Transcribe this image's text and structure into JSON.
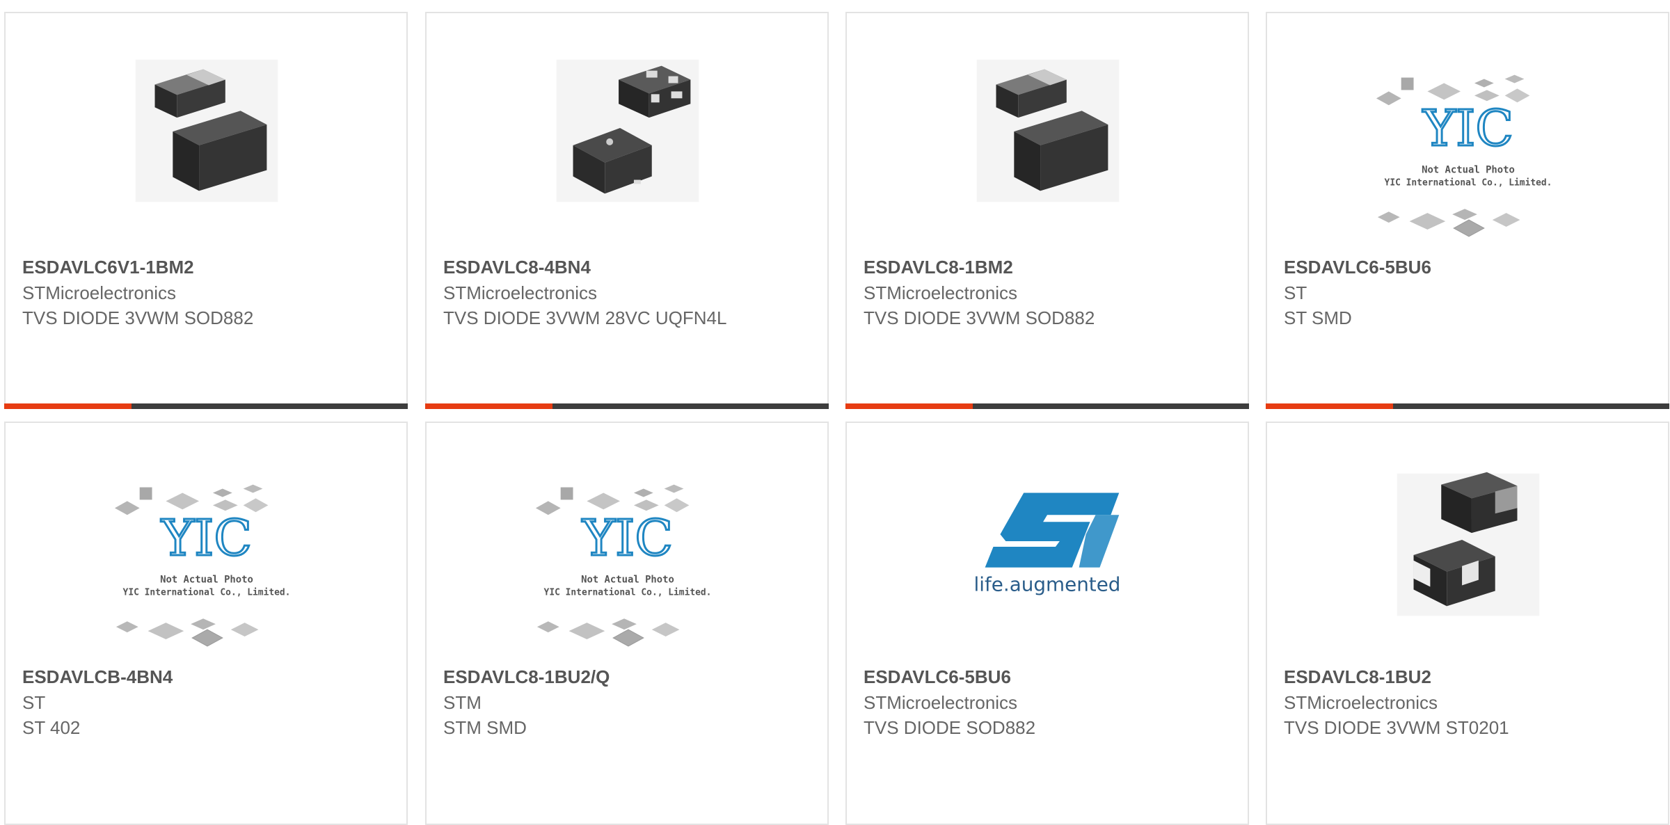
{
  "products": [
    {
      "part_number": "ESDAVLC6V1-1BM2",
      "manufacturer": "STMicroelectronics",
      "description": "TVS DIODE 3VWM SOD882",
      "image": "sod882-package-photo"
    },
    {
      "part_number": "ESDAVLC8-4BN4",
      "manufacturer": "STMicroelectronics",
      "description": "TVS DIODE 3VWM 28VC UQFN4L",
      "image": "uqfn4l-package-photo"
    },
    {
      "part_number": "ESDAVLC8-1BM2",
      "manufacturer": "STMicroelectronics",
      "description": "TVS DIODE 3VWM SOD882",
      "image": "sod882-package-photo"
    },
    {
      "part_number": "ESDAVLC6-5BU6",
      "manufacturer": "ST",
      "description": "ST SMD",
      "image": "not-actual-photo-placeholder"
    },
    {
      "part_number": "ESDAVLCB-4BN4",
      "manufacturer": "ST",
      "description": "ST 402",
      "image": "not-actual-photo-placeholder"
    },
    {
      "part_number": "ESDAVLC8-1BU2/Q",
      "manufacturer": "STM",
      "description": "STM SMD",
      "image": "not-actual-photo-placeholder"
    },
    {
      "part_number": "ESDAVLC6-5BU6",
      "manufacturer": "STMicroelectronics",
      "description": "TVS DIODE SOD882",
      "image": "st-life-augmented-logo"
    },
    {
      "part_number": "ESDAVLC8-1BU2",
      "manufacturer": "STMicroelectronics",
      "description": "TVS DIODE 3VWM ST0201",
      "image": "st0201-package-photo"
    }
  ],
  "placeholder": {
    "line1": "Not Actual Photo",
    "line2": "YIC International Co., Limited.",
    "logo_text": "YIC"
  },
  "st_logo": {
    "tagline": "life.augmented"
  },
  "colors": {
    "accent": "#e63c12",
    "bar": "#3d3d3d",
    "border": "#e3e3e3",
    "st_blue": "#1f86c2"
  }
}
